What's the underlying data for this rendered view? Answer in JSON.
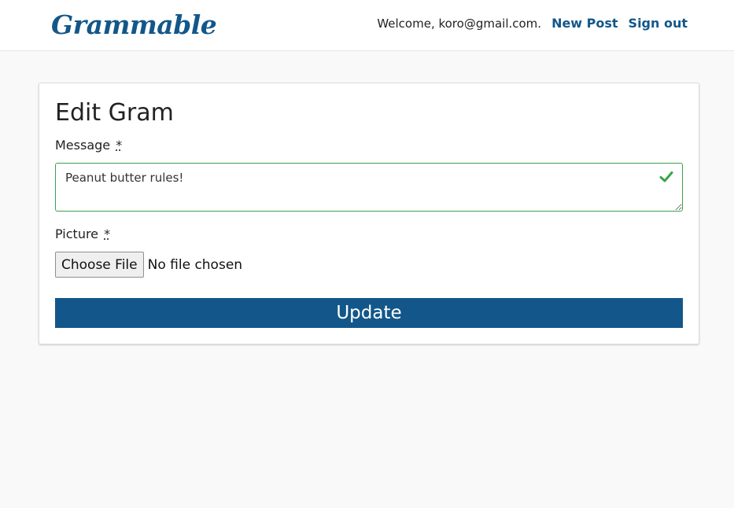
{
  "nav": {
    "brand": "Grammable",
    "welcome": "Welcome, koro@gmail.com.",
    "new_post": "New Post",
    "sign_out": "Sign out"
  },
  "form": {
    "title": "Edit Gram",
    "message_label": "Message",
    "picture_label": "Picture",
    "required_marker": "*",
    "message_value": "Peanut butter rules!",
    "message_valid_icon": "check-icon",
    "file_button": "Choose File",
    "file_status": "No file chosen",
    "submit_label": "Update"
  },
  "colors": {
    "brand": "#13578a",
    "valid": "#3aa34a",
    "page_bg": "#f9f9f9"
  }
}
